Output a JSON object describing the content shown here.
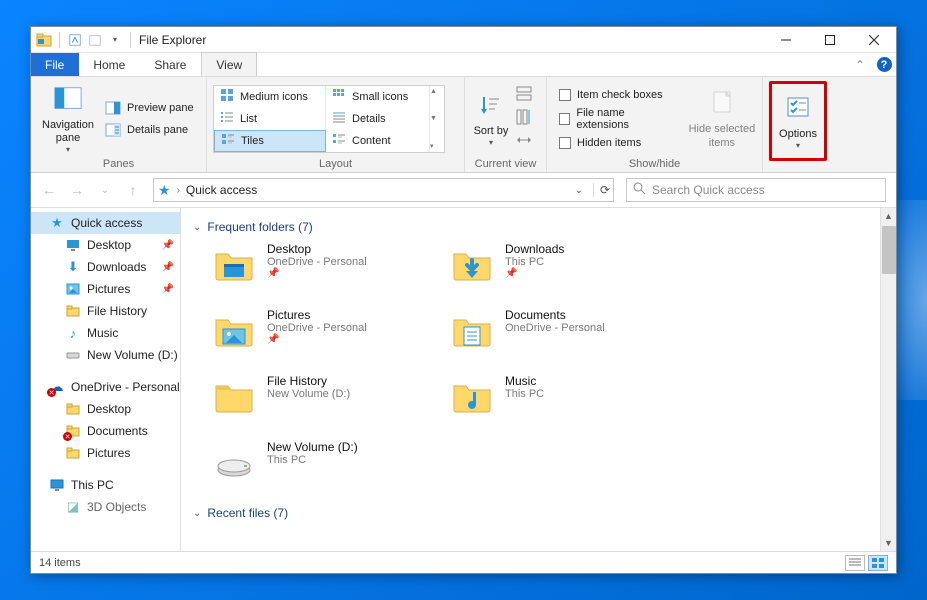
{
  "title": "File Explorer",
  "tabs": {
    "file": "File",
    "home": "Home",
    "share": "Share",
    "view": "View"
  },
  "ribbon": {
    "panes": {
      "group_label": "Panes",
      "navigation_pane": "Navigation pane",
      "preview_pane": "Preview pane",
      "details_pane": "Details pane"
    },
    "layout": {
      "group_label": "Layout",
      "medium_icons": "Medium icons",
      "small_icons": "Small icons",
      "list": "List",
      "details": "Details",
      "tiles": "Tiles",
      "content": "Content"
    },
    "current_view": {
      "group_label": "Current view",
      "sort_by": "Sort by"
    },
    "show_hide": {
      "group_label": "Show/hide",
      "item_check_boxes": "Item check boxes",
      "file_name_extensions": "File name extensions",
      "hidden_items": "Hidden items",
      "hide_selected": "Hide selected items"
    },
    "options": "Options"
  },
  "address": {
    "path": "Quick access"
  },
  "search": {
    "placeholder": "Search Quick access"
  },
  "sidebar": {
    "quick_access": "Quick access",
    "items_qa": [
      {
        "label": "Desktop",
        "pinned": true
      },
      {
        "label": "Downloads",
        "pinned": true
      },
      {
        "label": "Pictures",
        "pinned": true
      },
      {
        "label": "File History",
        "pinned": false
      },
      {
        "label": "Music",
        "pinned": false
      },
      {
        "label": "New Volume (D:)",
        "pinned": false
      }
    ],
    "onedrive": "OneDrive - Personal",
    "items_od": [
      {
        "label": "Desktop"
      },
      {
        "label": "Documents"
      },
      {
        "label": "Pictures"
      }
    ],
    "this_pc": "This PC",
    "items_pc": [
      {
        "label": "3D Objects"
      }
    ]
  },
  "content": {
    "frequent_header": "Frequent folders (7)",
    "recent_header": "Recent files (7)",
    "tiles": [
      {
        "name": "Desktop",
        "sub": "OneDrive - Personal",
        "pinned": true,
        "icon": "desktop"
      },
      {
        "name": "Downloads",
        "sub": "This PC",
        "pinned": true,
        "icon": "downloads"
      },
      {
        "name": "Pictures",
        "sub": "OneDrive - Personal",
        "pinned": true,
        "icon": "pictures"
      },
      {
        "name": "Documents",
        "sub": "OneDrive - Personal",
        "pinned": false,
        "icon": "documents"
      },
      {
        "name": "File History",
        "sub": "New Volume (D:)",
        "pinned": false,
        "icon": "folder"
      },
      {
        "name": "Music",
        "sub": "This PC",
        "pinned": false,
        "icon": "music"
      },
      {
        "name": "New Volume (D:)",
        "sub": "This PC",
        "pinned": false,
        "icon": "drive"
      }
    ]
  },
  "status": {
    "items": "14 items"
  }
}
